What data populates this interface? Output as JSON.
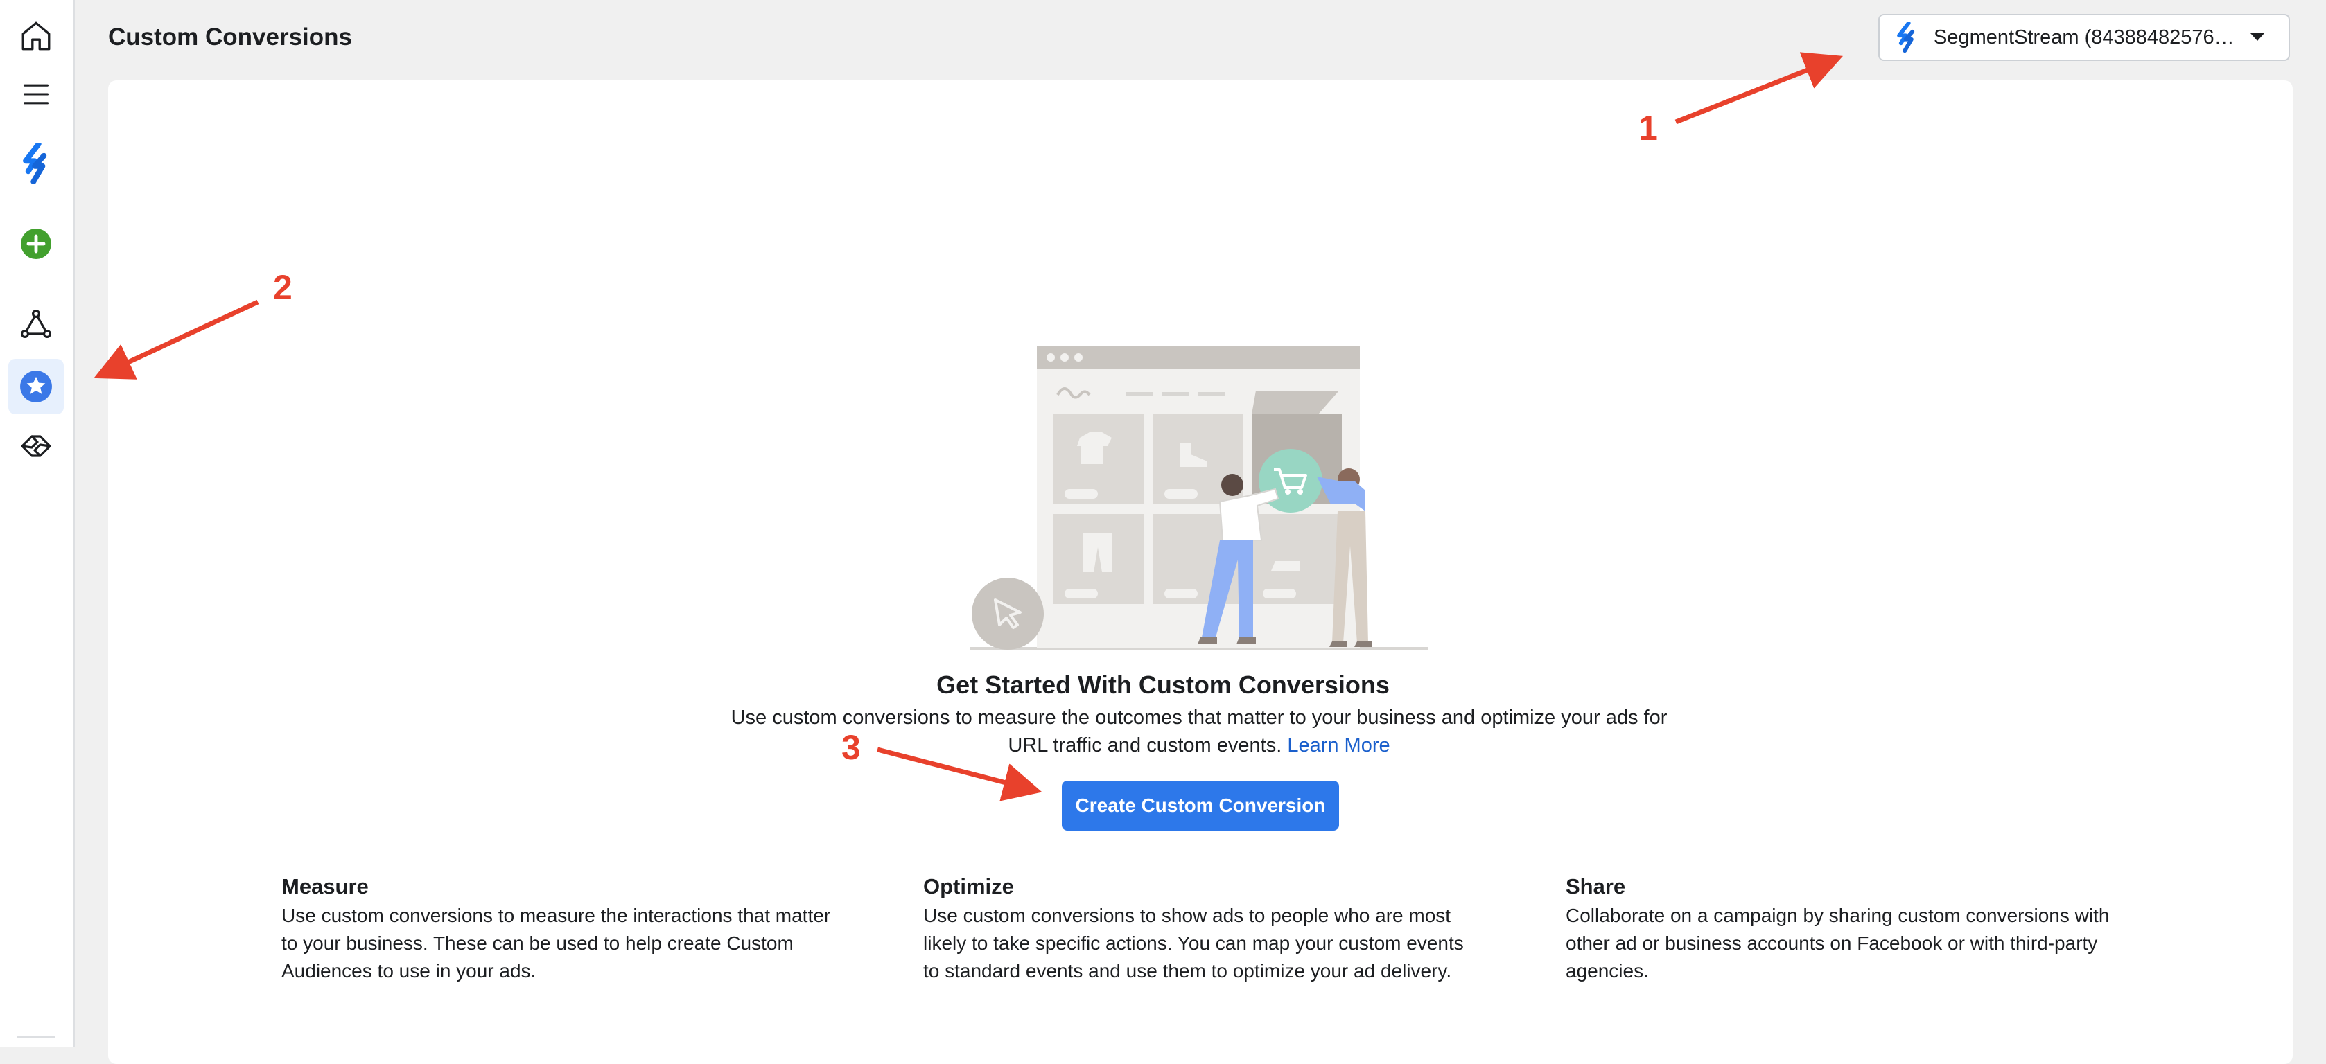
{
  "header": {
    "title": "Custom Conversions",
    "account_selector": "SegmentStream (843884825767…"
  },
  "sidebar": {
    "items": [
      {
        "name": "home-icon",
        "active": false
      },
      {
        "name": "menu-icon",
        "active": false
      },
      {
        "name": "segmentstream-logo-icon",
        "active": false
      },
      {
        "name": "add-icon",
        "active": false
      },
      {
        "name": "events-network-icon",
        "active": false
      },
      {
        "name": "custom-conversions-star-icon",
        "active": true
      },
      {
        "name": "partner-integrations-icon",
        "active": false
      }
    ]
  },
  "main": {
    "title": "Get Started With Custom Conversions",
    "description": "Use custom conversions to measure the outcomes that matter to your business and optimize your ads for URL traffic and custom events.",
    "learn_more": "Learn More",
    "cta": "Create Custom Conversion",
    "features": [
      {
        "heading": "Measure",
        "text": "Use custom conversions to measure the interactions that matter to your business. These can be used to help create Custom Audiences to use in your ads."
      },
      {
        "heading": "Optimize",
        "text": "Use custom conversions to show ads to people who are most likely to take specific actions. You can map your custom events to standard events and use them to optimize your ad delivery."
      },
      {
        "heading": "Share",
        "text": "Collaborate on a campaign by sharing custom conversions with other ad or business accounts on Facebook or with third-party agencies."
      }
    ]
  },
  "annotations": {
    "labels": [
      "1",
      "2",
      "3"
    ],
    "color": "#e8412c"
  },
  "colors": {
    "primary_button": "#2d78ea",
    "link": "#1a5fcc",
    "active_nav": "#e7f0fd",
    "add_green": "#42a02e"
  }
}
